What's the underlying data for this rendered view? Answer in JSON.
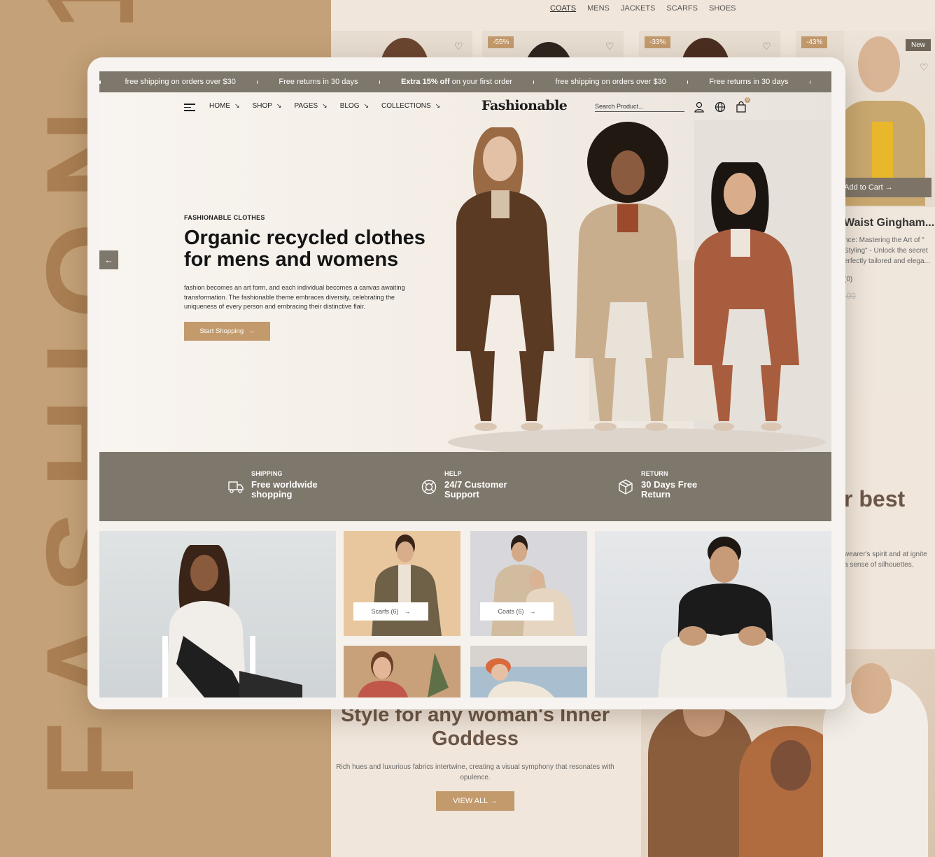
{
  "background": {
    "vertical_word": "FASHION 1",
    "categories": [
      "COATS",
      "MENS",
      "JACKETS",
      "SCARFS",
      "SHOES"
    ],
    "discount_badges": [
      "-55%",
      "-33%",
      "-43%"
    ],
    "new_badge": "New",
    "add_to_cart": "Add to Cart →",
    "product_title": "Waist Gingham...",
    "product_desc": "nce: Mastering the Art of \" Styling\" - Unlock the secret erfectly tailored and elega...",
    "product_reviews": "(0)",
    "product_price": ".00",
    "best_heading": "r best",
    "best_desc": "wearer's spirit and at ignite a sense of silhouettes.",
    "goddess_title": "Style for any woman's Inner Goddess",
    "goddess_desc": "Rich hues and luxurious fabrics intertwine, creating a visual symphony that resonates with opulence.",
    "view_all": "VIEW ALL →"
  },
  "marquee": {
    "items": [
      {
        "text": "free shipping on orders over $30",
        "bold": ""
      },
      {
        "text": "Free returns in 30 days",
        "bold": ""
      },
      {
        "text": " on your first order",
        "bold": "Extra 15% off"
      },
      {
        "text": "free shipping on orders over $30",
        "bold": ""
      },
      {
        "text": "Free returns in 30 days",
        "bold": ""
      }
    ]
  },
  "nav": {
    "links": [
      "HOME",
      "SHOP",
      "PAGES",
      "BLOG",
      "COLLECTIONS"
    ],
    "logo": "Fashionable",
    "search_placeholder": "Search Product...",
    "cart_count": "0"
  },
  "hero": {
    "eyebrow": "FASHIONABLE CLOTHES",
    "title_line1": "Organic recycled clothes",
    "title_line2": "for mens and womens",
    "description": "fashion becomes an art form, and each individual becomes a canvas awaiting transformation. The fashionable theme embraces diversity, celebrating the uniqueness of every person and embracing their distinctive flair.",
    "button": "Start Shopping",
    "prev_arrow": "←",
    "next_arrow": "→"
  },
  "features": [
    {
      "label": "SHIPPING",
      "line1": "Free worldwide",
      "line2": "shopping",
      "icon": "truck-icon"
    },
    {
      "label": "HELP",
      "line1": "24/7 Customer",
      "line2": "Support",
      "icon": "lifebuoy-icon"
    },
    {
      "label": "RETURN",
      "line1": "30 Days Free",
      "line2": "Return",
      "icon": "box-icon"
    }
  ],
  "collections": {
    "scarfs": "Scarfs (6)",
    "coats": "Coats (6)"
  },
  "colors": {
    "accent": "#c39a6c",
    "band": "#7e776b",
    "left_panel": "#c4a178"
  }
}
